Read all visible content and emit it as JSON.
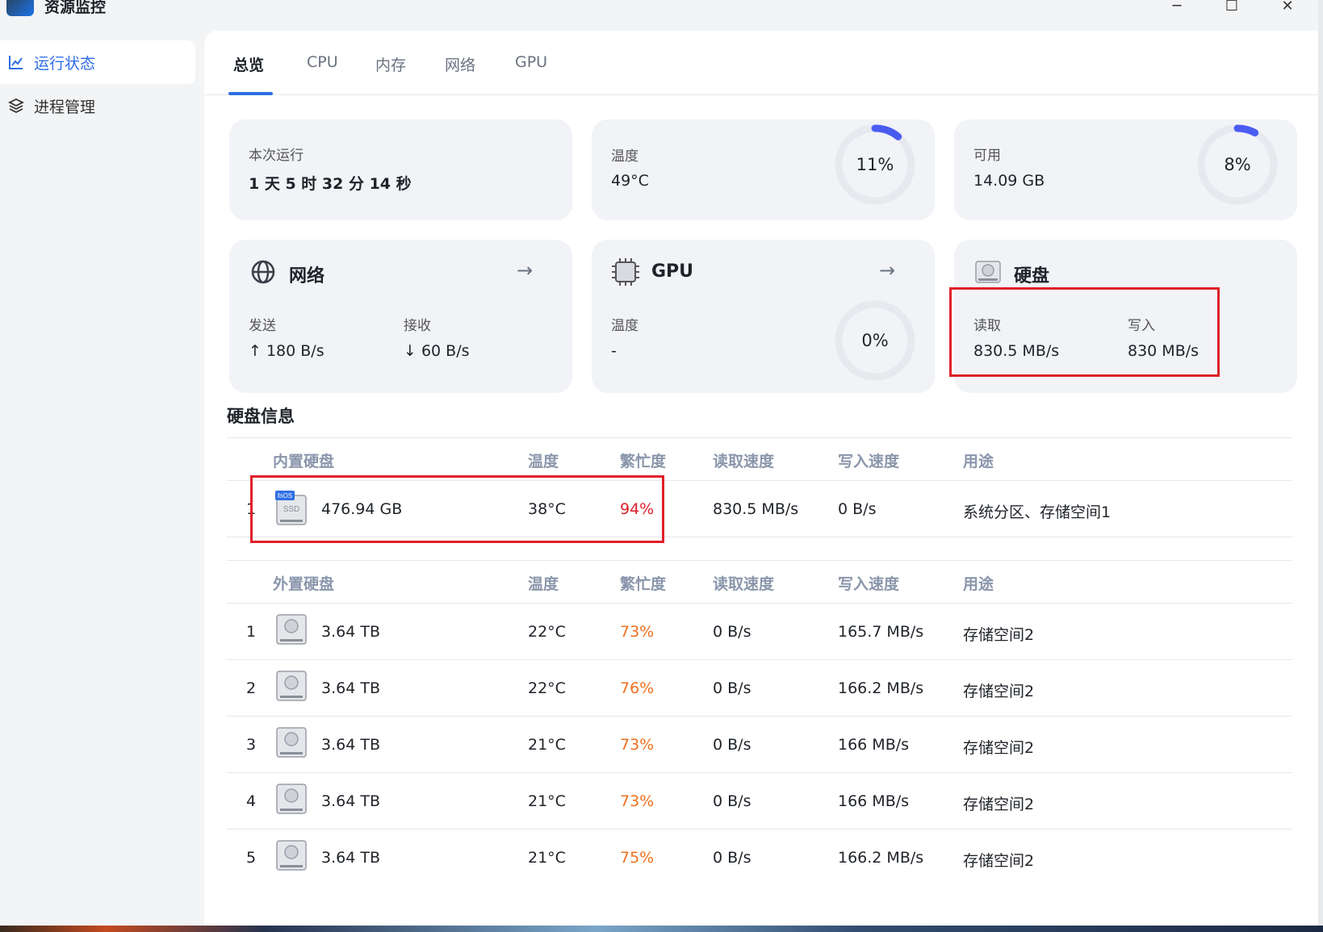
{
  "window": {
    "title": "资源监控",
    "controls": {
      "minimize": "─",
      "maximize": "☐",
      "close": "✕"
    }
  },
  "sidebar": {
    "items": [
      {
        "label": "运行状态",
        "icon": "line-chart-icon",
        "active": true
      },
      {
        "label": "进程管理",
        "icon": "layers-icon",
        "active": false
      }
    ]
  },
  "tabs": [
    {
      "label": "总览",
      "active": true
    },
    {
      "label": "CPU",
      "active": false
    },
    {
      "label": "内存",
      "active": false
    },
    {
      "label": "网络",
      "active": false
    },
    {
      "label": "GPU",
      "active": false
    }
  ],
  "cards": {
    "uptime": {
      "label": "本次运行",
      "value": "1 天 5 时 32 分 14 秒"
    },
    "cpu": {
      "label": "温度",
      "value": "49°C",
      "percent_text": "11%",
      "percent": 11
    },
    "memory": {
      "label": "可用",
      "value": "14.09 GB",
      "percent_text": "8%",
      "percent": 8
    },
    "network": {
      "title": "网络",
      "send_label": "发送",
      "send_value": "↑ 180 B/s",
      "recv_label": "接收",
      "recv_value": "↓ 60 B/s"
    },
    "gpu": {
      "title": "GPU",
      "label": "温度",
      "value": "-",
      "percent_text": "0%",
      "percent": 0
    },
    "disk": {
      "title": "硬盘",
      "read_label": "读取",
      "read_value": "830.5 MB/s",
      "write_label": "写入",
      "write_value": "830 MB/s"
    }
  },
  "disk_info": {
    "title": "硬盘信息",
    "internal": {
      "headers": [
        "内置硬盘",
        "温度",
        "繁忙度",
        "读取速度",
        "写入速度",
        "用途"
      ],
      "rows": [
        {
          "index": "1",
          "badge": "fnOS",
          "type": "SSD",
          "size": "476.94 GB",
          "temp": "38°C",
          "busy": "94%",
          "read": "830.5 MB/s",
          "write": "0 B/s",
          "usage": "系统分区、存储空间1"
        }
      ]
    },
    "external": {
      "headers": [
        "外置硬盘",
        "温度",
        "繁忙度",
        "读取速度",
        "写入速度",
        "用途"
      ],
      "rows": [
        {
          "index": "1",
          "size": "3.64 TB",
          "temp": "22°C",
          "busy": "73%",
          "read": "0 B/s",
          "write": "165.7 MB/s",
          "usage": "存储空间2"
        },
        {
          "index": "2",
          "size": "3.64 TB",
          "temp": "22°C",
          "busy": "76%",
          "read": "0 B/s",
          "write": "166.2 MB/s",
          "usage": "存储空间2"
        },
        {
          "index": "3",
          "size": "3.64 TB",
          "temp": "21°C",
          "busy": "73%",
          "read": "0 B/s",
          "write": "166 MB/s",
          "usage": "存储空间2"
        },
        {
          "index": "4",
          "size": "3.64 TB",
          "temp": "21°C",
          "busy": "73%",
          "read": "0 B/s",
          "write": "166 MB/s",
          "usage": "存储空间2"
        },
        {
          "index": "5",
          "size": "3.64 TB",
          "temp": "21°C",
          "busy": "75%",
          "read": "0 B/s",
          "write": "166.2 MB/s",
          "usage": "存储空间2"
        }
      ]
    }
  },
  "colors": {
    "accent": "#2f6ee5",
    "ring_track": "#e7e9ee",
    "ring_fill": "#4a5cf0",
    "busy_high": "#e0202a",
    "busy_mid": "#f0701e",
    "highlight_box": "#e0202a"
  }
}
